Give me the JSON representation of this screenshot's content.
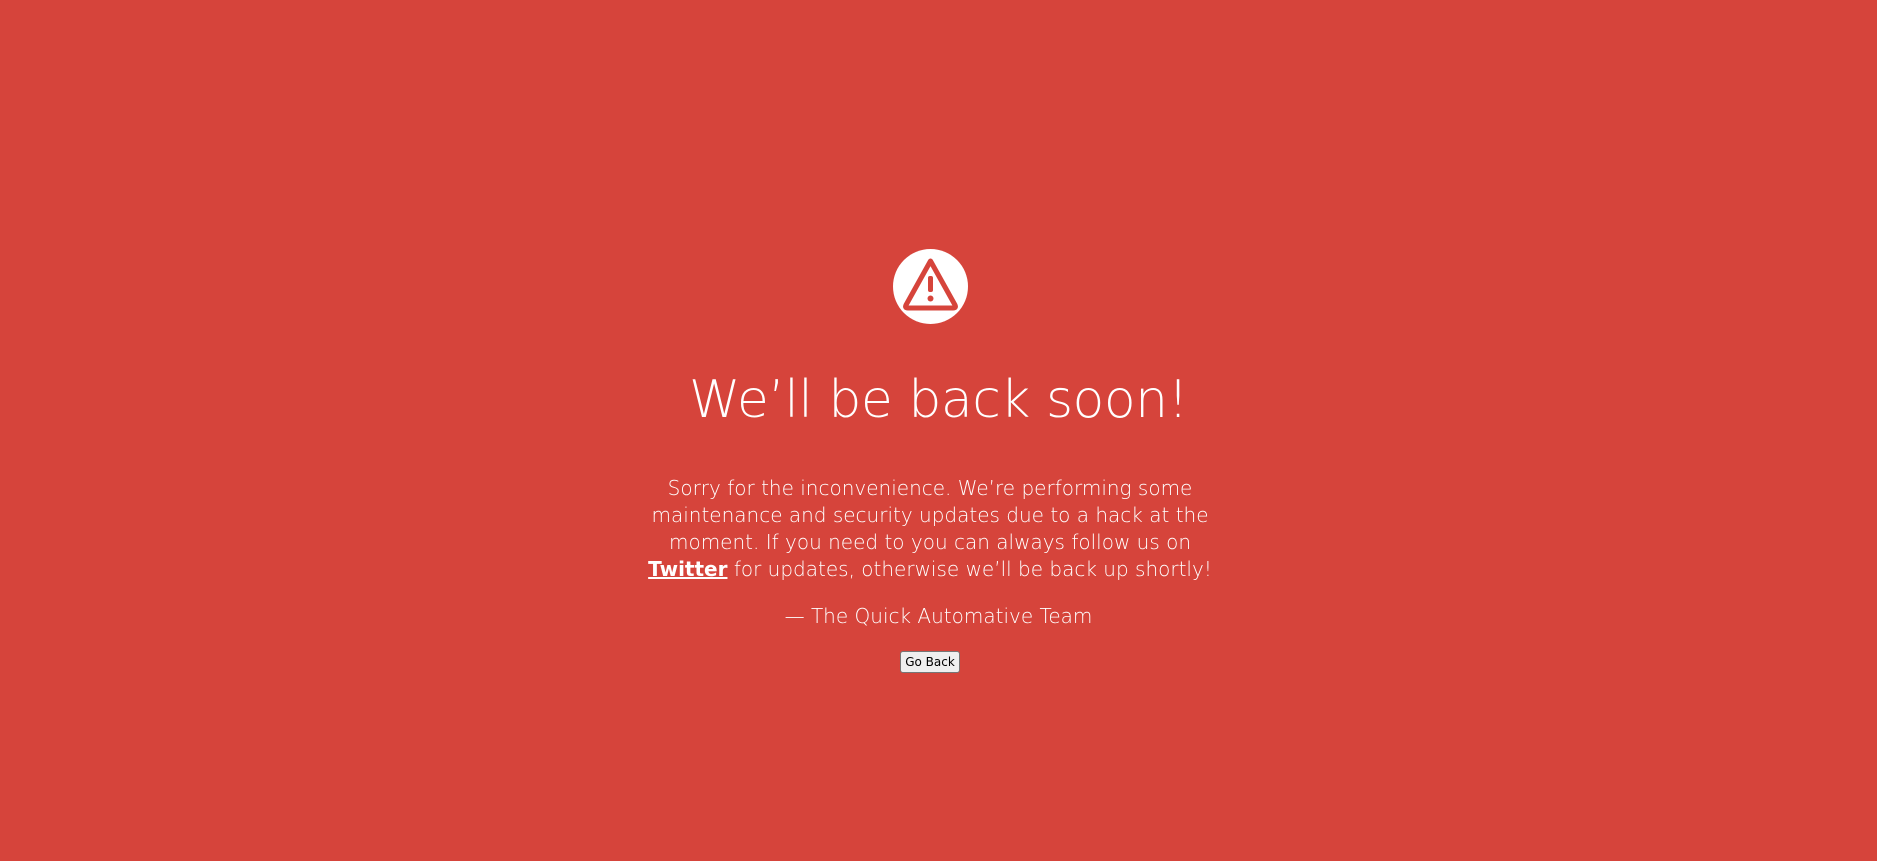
{
  "page": {
    "background_color": "#d6443b",
    "icon": "warning-triangle-icon"
  },
  "headline": "We’ll be back soon!",
  "message": {
    "before_link": "Sorry for the inconvenience. We’re performing some maintenance and security updates due to a hack at the moment. If you need to you can always follow us on ",
    "link_label": "Twitter",
    "after_link": " for updates, otherwise we’ll be back up shortly!"
  },
  "signature": "— The Quick Automative Team",
  "go_back_label": "Go Back"
}
